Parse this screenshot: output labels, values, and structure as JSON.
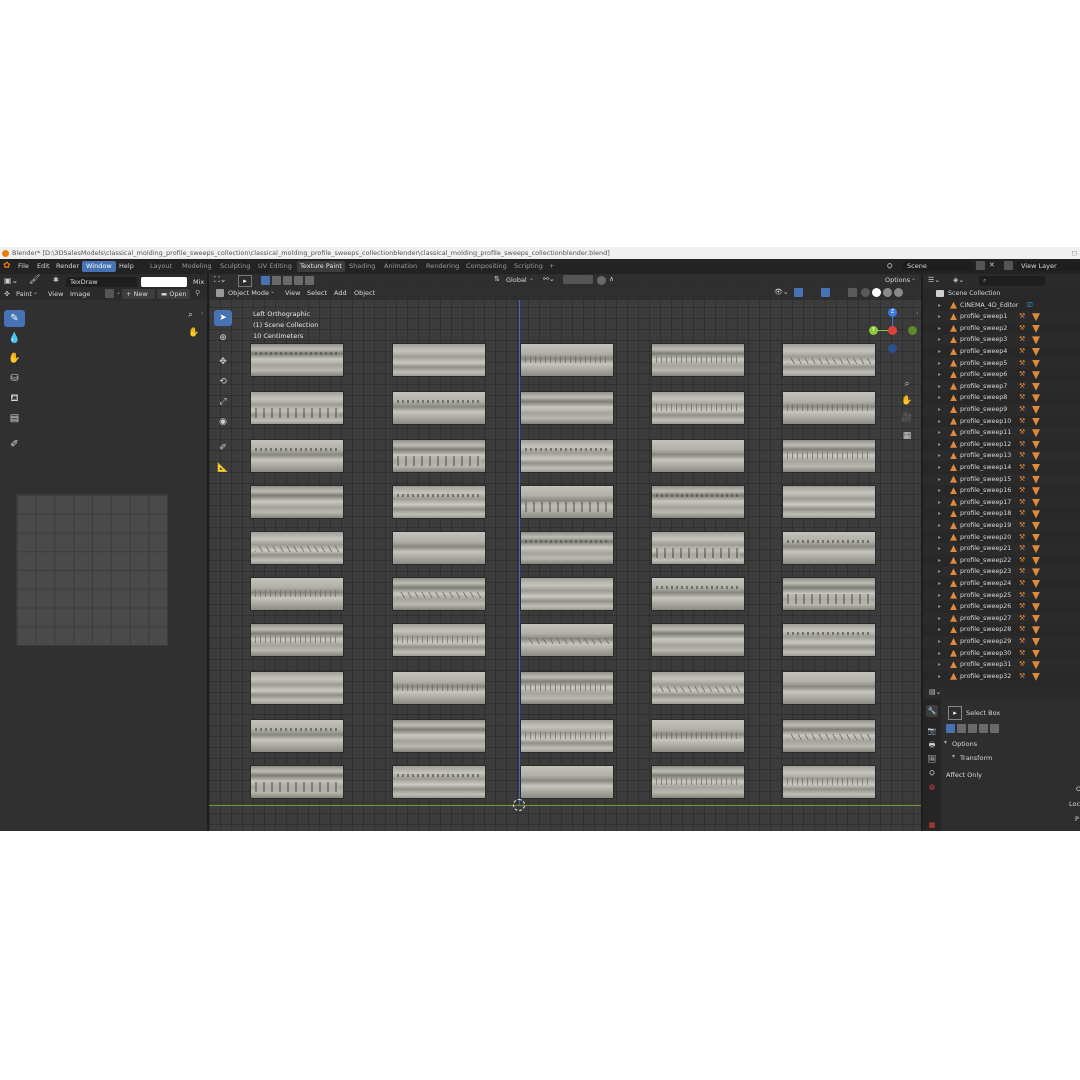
{
  "window": {
    "title": "Blender* [D:\\3DSalesModels\\classical_molding_profile_sweeps_collection\\classical_molding_profile_sweeps_collectionblender\\classical_molding_profile_sweeps_collectionblender.blend]"
  },
  "menubar": {
    "menus": [
      "File",
      "Edit",
      "Render",
      "Window",
      "Help"
    ],
    "active_menu": "Window",
    "workspaces": [
      "Layout",
      "Modeling",
      "Sculpting",
      "UV Editing",
      "Texture Paint",
      "Shading",
      "Animation",
      "Rendering",
      "Compositing",
      "Scripting",
      "+"
    ],
    "active_workspace": "Texture Paint",
    "scene": "Scene",
    "view_layer": "View Layer"
  },
  "image_editor": {
    "brush_name": "TexDraw",
    "blend_mode": "Mix",
    "mode": "Paint",
    "menus": [
      "View",
      "Image"
    ],
    "new_label": "New",
    "open_label": "Open",
    "tools": [
      "brush-icon",
      "drop-icon",
      "smear-icon",
      "clone-icon",
      "fill-icon",
      "mask-icon",
      "annotate-icon"
    ]
  },
  "viewport": {
    "mode": "Object Mode",
    "menus": [
      "View",
      "Select",
      "Add",
      "Object"
    ],
    "orientation": "Global",
    "options_label": "Options",
    "view_name": "Left Orthographic",
    "collection_info": "(1) Scene Collection",
    "scale_info": "10 Centimeters",
    "gizmo": {
      "z": "Z",
      "y": "Y"
    },
    "accent_colors": {
      "selection": "#4772b3",
      "x_axis": "#e0413c",
      "y_axis": "#8ac83c",
      "z_axis": "#3c7ae0"
    }
  },
  "outliner": {
    "root": "Scene Collection",
    "items": [
      "CINEMA_4D_Editor",
      "profile_sweep1",
      "profile_sweep2",
      "profile_sweep3",
      "profile_sweep4",
      "profile_sweep5",
      "profile_sweep6",
      "profile_sweep7",
      "profile_sweep8",
      "profile_sweep9",
      "profile_sweep10",
      "profile_sweep11",
      "profile_sweep12",
      "profile_sweep13",
      "profile_sweep14",
      "profile_sweep15",
      "profile_sweep16",
      "profile_sweep17",
      "profile_sweep18",
      "profile_sweep19",
      "profile_sweep20",
      "profile_sweep21",
      "profile_sweep22",
      "profile_sweep23",
      "profile_sweep24",
      "profile_sweep25",
      "profile_sweep26",
      "profile_sweep27",
      "profile_sweep28",
      "profile_sweep29",
      "profile_sweep30",
      "profile_sweep31",
      "profile_sweep32"
    ]
  },
  "properties": {
    "active_tool": "Select Box",
    "section": "Options",
    "subsection": "Transform",
    "affect_only": "Affect Only",
    "right_labels": [
      "O",
      "Loc",
      "P"
    ]
  }
}
